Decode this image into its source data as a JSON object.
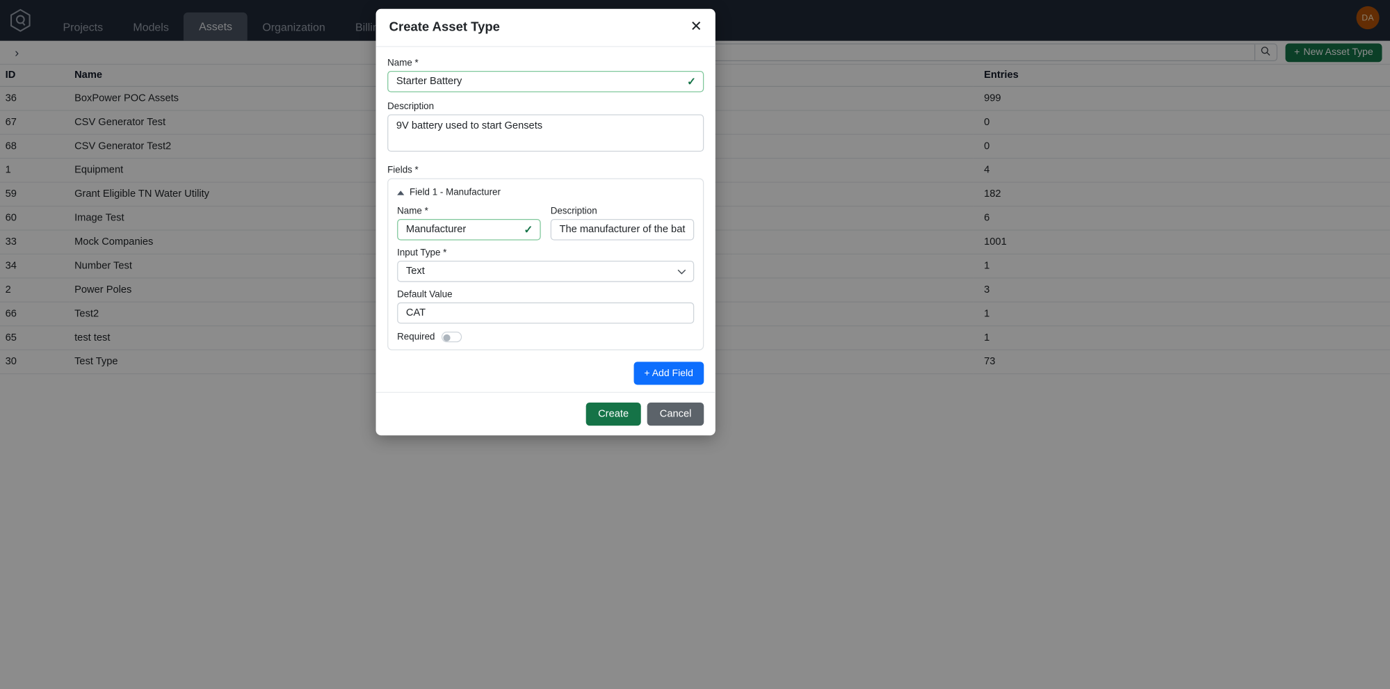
{
  "nav": {
    "logo_icon": "hexagon-q-logo-icon",
    "tabs": [
      {
        "label": "Projects",
        "active": false
      },
      {
        "label": "Models",
        "active": false
      },
      {
        "label": "Assets",
        "active": true
      },
      {
        "label": "Organization",
        "active": false
      },
      {
        "label": "Billing",
        "active": false
      }
    ],
    "avatar_initials": "DA"
  },
  "toolbar": {
    "expand_icon": "chevron-right-icon",
    "search_value": "",
    "search_placeholder": "",
    "search_icon": "search-icon",
    "new_asset_type_label": "New Asset Type",
    "new_asset_type_plus": "+"
  },
  "table": {
    "columns": [
      "ID",
      "Name",
      "Entries"
    ],
    "rows": [
      {
        "id": "36",
        "name": "BoxPower POC Assets",
        "entries": "999"
      },
      {
        "id": "67",
        "name": "CSV Generator Test",
        "entries": "0"
      },
      {
        "id": "68",
        "name": "CSV Generator Test2",
        "entries": "0"
      },
      {
        "id": "1",
        "name": "Equipment",
        "entries": "4"
      },
      {
        "id": "59",
        "name": "Grant Eligible TN Water Utility",
        "entries": "182"
      },
      {
        "id": "60",
        "name": "Image Test",
        "entries": "6"
      },
      {
        "id": "33",
        "name": "Mock Companies",
        "entries": "1001"
      },
      {
        "id": "34",
        "name": "Number Test",
        "entries": "1"
      },
      {
        "id": "2",
        "name": "Power Poles",
        "entries": "3"
      },
      {
        "id": "66",
        "name": "Test2",
        "entries": "1"
      },
      {
        "id": "65",
        "name": "test test",
        "entries": "1"
      },
      {
        "id": "30",
        "name": "Test Type",
        "entries": "73"
      }
    ]
  },
  "modal": {
    "title": "Create Asset Type",
    "close_icon": "close-icon",
    "name_label": "Name *",
    "name_value": "Starter Battery",
    "name_valid_icon": "check-icon",
    "description_label": "Description",
    "description_value": "9V battery used to start Gensets",
    "fields_label": "Fields *",
    "field": {
      "header": "Field 1 - Manufacturer",
      "collapse_icon": "caret-up-icon",
      "name_label": "Name *",
      "name_value": "Manufacturer",
      "name_valid_icon": "check-icon",
      "description_label": "Description",
      "description_value": "The manufacturer of the battery",
      "input_type_label": "Input Type *",
      "input_type_value": "Text",
      "input_type_chevron": "chevron-down-icon",
      "default_value_label": "Default Value",
      "default_value": "CAT",
      "required_label": "Required",
      "required_on": false
    },
    "add_field_label": "+ Add Field",
    "create_label": "Create",
    "cancel_label": "Cancel"
  },
  "colors": {
    "nav_bg": "#1f2937",
    "accent_green": "#157347",
    "accent_blue": "#0d6efd",
    "cancel_gray": "#5c636a",
    "avatar_orange": "#b45309",
    "valid_green": "#7fc79b"
  }
}
